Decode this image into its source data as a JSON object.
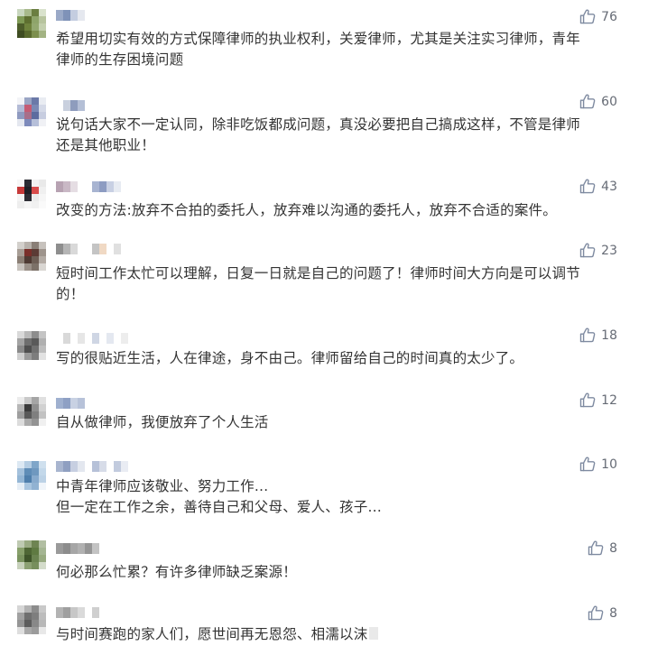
{
  "like_icon": "thumbs-up-icon",
  "colors": {
    "text": "#333333",
    "meta": "#666b75",
    "like_icon": "#7e8aa0"
  },
  "comments": [
    {
      "likes": "76",
      "text": "希望用切实有效的方式保障律师的执业权利，关爱律师，尤其是关注实习律师，青年\n律师的生存困境问题"
    },
    {
      "likes": "60",
      "text": "说句话大家不一定认同，除非吃饭都成问题，真没必要把自己搞成这样，不管是律师\n还是其他职业！"
    },
    {
      "likes": "43",
      "text": "改变的方法:放弃不合拍的委托人，放弃难以沟通的委托人，放弃不合适的案件。"
    },
    {
      "likes": "23",
      "text": "短时间工作太忙可以理解，日复一日就是自己的问题了！律师时间大方向是可以调节\n的！"
    },
    {
      "likes": "18",
      "text": "写的很贴近生活，人在律途，身不由己。律师留给自己的时间真的太少了。"
    },
    {
      "likes": "12",
      "text": "自从做律师，我便放弃了个人生活"
    },
    {
      "likes": "10",
      "text": "中青年律师应该敬业、努力工作…\n但一定在工作之余，善待自己和父母、爱人、孩子…"
    },
    {
      "likes": "8",
      "text": "何必那么忙累？有许多律师缺乏案源！"
    },
    {
      "likes": "8",
      "text": "与时间赛跑的家人们，愿世间再无恩怨、相濡以沫"
    }
  ]
}
